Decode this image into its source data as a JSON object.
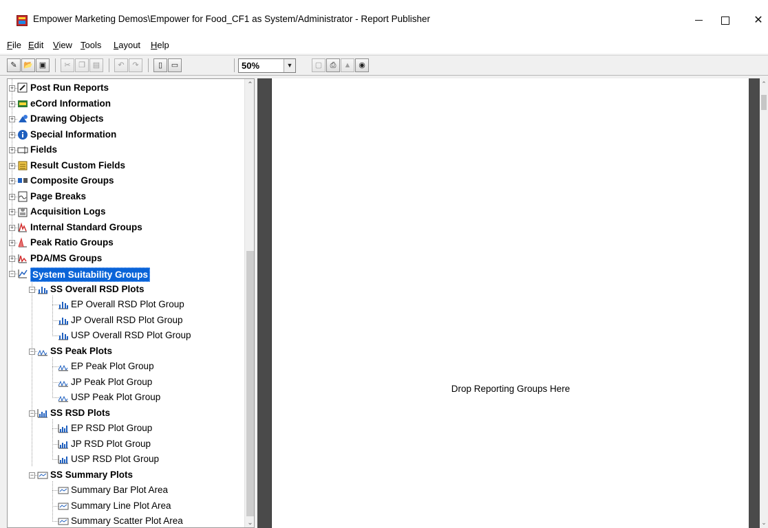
{
  "window": {
    "title": "Empower Marketing Demos\\Empower for Food_CF1 as System/Administrator - Report Publisher",
    "minimize_icon": "minimize-icon",
    "maximize_icon": "maximize-icon",
    "close_glyph": "✕"
  },
  "menu": [
    {
      "pre": "",
      "key": "F",
      "post": "ile"
    },
    {
      "pre": "",
      "key": "E",
      "post": "dit"
    },
    {
      "pre": "",
      "key": "V",
      "post": "iew"
    },
    {
      "pre": "",
      "key": "T",
      "post": "ools"
    },
    {
      "pre": "",
      "key": "L",
      "post": "ayout"
    },
    {
      "pre": "",
      "key": "H",
      "post": "elp"
    }
  ],
  "toolbar": {
    "zoom_value": "50%",
    "zoom_arrow": "▼",
    "buttons": [
      {
        "name": "wizard-icon",
        "glyph": "✎",
        "disabled": false
      },
      {
        "name": "open-folder-icon",
        "glyph": "📂",
        "disabled": false
      },
      {
        "name": "save-icon",
        "glyph": "▣",
        "disabled": false
      },
      {
        "name": "cut-icon",
        "glyph": "✂",
        "disabled": true
      },
      {
        "name": "copy-icon",
        "glyph": "❐",
        "disabled": true
      },
      {
        "name": "paste-icon",
        "glyph": "▤",
        "disabled": true
      },
      {
        "name": "undo-icon",
        "glyph": "↶",
        "disabled": true
      },
      {
        "name": "redo-icon",
        "glyph": "↷",
        "disabled": true
      },
      {
        "name": "single-page-icon",
        "glyph": "▯",
        "disabled": false
      },
      {
        "name": "page-layout-icon",
        "glyph": "▭",
        "disabled": false
      },
      {
        "name": "print-preview-icon",
        "glyph": "▢",
        "disabled": true
      },
      {
        "name": "print-icon",
        "glyph": "⎙",
        "disabled": false
      },
      {
        "name": "mountain-icon",
        "glyph": "▲",
        "disabled": true
      },
      {
        "name": "globe-icon",
        "glyph": "◉",
        "disabled": false
      }
    ]
  },
  "tree": {
    "scroll_up": "⌃",
    "scroll_down": "⌄",
    "items": [
      {
        "label": "Post Run Reports",
        "icon": "post-run-reports-icon",
        "bold": true,
        "level": 0,
        "expander": "+"
      },
      {
        "label": "eCord Information",
        "icon": "ecord-icon",
        "bold": true,
        "level": 0,
        "expander": "+"
      },
      {
        "label": "Drawing Objects",
        "icon": "drawing-objects-icon",
        "bold": true,
        "level": 0,
        "expander": "+"
      },
      {
        "label": "Special Information",
        "icon": "info-icon",
        "bold": true,
        "level": 0,
        "expander": "+"
      },
      {
        "label": "Fields",
        "icon": "fields-icon",
        "bold": true,
        "level": 0,
        "expander": "+"
      },
      {
        "label": "Result Custom Fields",
        "icon": "custom-fields-icon",
        "bold": true,
        "level": 0,
        "expander": "+"
      },
      {
        "label": "Composite Groups",
        "icon": "composite-groups-icon",
        "bold": true,
        "level": 0,
        "expander": "+"
      },
      {
        "label": "Page Breaks",
        "icon": "page-breaks-icon",
        "bold": true,
        "level": 0,
        "expander": "+"
      },
      {
        "label": "Acquisition Logs",
        "icon": "acquisition-logs-icon",
        "bold": true,
        "level": 0,
        "expander": "+"
      },
      {
        "label": "Internal Standard Groups",
        "icon": "internal-standard-icon",
        "bold": true,
        "level": 0,
        "expander": "+"
      },
      {
        "label": "Peak Ratio Groups",
        "icon": "peak-ratio-icon",
        "bold": true,
        "level": 0,
        "expander": "+"
      },
      {
        "label": "PDA/MS Groups",
        "icon": "pda-ms-icon",
        "bold": true,
        "level": 0,
        "expander": "+"
      },
      {
        "label": "System Suitability Groups",
        "icon": "system-suitability-icon",
        "bold": true,
        "level": 0,
        "expander": "−",
        "selected": true
      },
      {
        "label": "SS Overall RSD Plots",
        "icon": "bar-plot-icon",
        "bold": true,
        "level": 1,
        "expander": "−"
      },
      {
        "label": "EP Overall RSD Plot Group",
        "icon": "bar-plot-icon",
        "bold": false,
        "level": 2
      },
      {
        "label": "JP Overall RSD Plot Group",
        "icon": "bar-plot-icon",
        "bold": false,
        "level": 2
      },
      {
        "label": "USP Overall RSD Plot Group",
        "icon": "bar-plot-icon",
        "bold": false,
        "level": 2
      },
      {
        "label": "SS Peak Plots",
        "icon": "peak-plot-icon",
        "bold": true,
        "level": 1,
        "expander": "−"
      },
      {
        "label": "EP Peak Plot Group",
        "icon": "peak-plot-icon",
        "bold": false,
        "level": 2
      },
      {
        "label": "JP Peak Plot Group",
        "icon": "peak-plot-icon",
        "bold": false,
        "level": 2
      },
      {
        "label": "USP Peak Plot Group",
        "icon": "peak-plot-icon",
        "bold": false,
        "level": 2
      },
      {
        "label": "SS RSD Plots",
        "icon": "rsd-plot-icon",
        "bold": true,
        "level": 1,
        "expander": "−"
      },
      {
        "label": "EP RSD Plot Group",
        "icon": "rsd-plot-icon",
        "bold": false,
        "level": 2
      },
      {
        "label": "JP RSD Plot Group",
        "icon": "rsd-plot-icon",
        "bold": false,
        "level": 2
      },
      {
        "label": "USP RSD Plot Group",
        "icon": "rsd-plot-icon",
        "bold": false,
        "level": 2
      },
      {
        "label": "SS Summary Plots",
        "icon": "summary-plot-icon",
        "bold": true,
        "level": 1,
        "expander": "−"
      },
      {
        "label": "Summary Bar Plot Area",
        "icon": "summary-plot-icon",
        "bold": false,
        "level": 2
      },
      {
        "label": "Summary Line Plot Area",
        "icon": "summary-plot-icon",
        "bold": false,
        "level": 2
      },
      {
        "label": "Summary Scatter Plot Area",
        "icon": "summary-plot-icon",
        "bold": false,
        "level": 2
      }
    ]
  },
  "canvas": {
    "drop_hint": "Drop Reporting Groups Here",
    "scroll_up": "⌃",
    "scroll_down": "⌄"
  },
  "colors": {
    "selection": "#0a64d8",
    "canvas_background": "#4a4a4a"
  }
}
